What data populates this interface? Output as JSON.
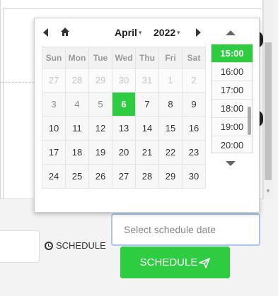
{
  "picker": {
    "month": "April",
    "year": "2022",
    "weekdays": [
      "Sun",
      "Mon",
      "Tue",
      "Wed",
      "Thu",
      "Fri",
      "Sat"
    ],
    "weeks": [
      [
        "27",
        "28",
        "29",
        "30",
        "31",
        "1",
        "2"
      ],
      [
        "3",
        "4",
        "5",
        "6",
        "7",
        "8",
        "9"
      ],
      [
        "10",
        "11",
        "12",
        "13",
        "14",
        "15",
        "16"
      ],
      [
        "17",
        "18",
        "19",
        "20",
        "21",
        "22",
        "23"
      ],
      [
        "24",
        "25",
        "26",
        "27",
        "28",
        "29",
        "30"
      ]
    ],
    "selected_day": "6",
    "times": [
      "15:00",
      "16:00",
      "17:00",
      "18:00",
      "19:00",
      "20:00"
    ],
    "selected_time": "15:00"
  },
  "form": {
    "schedule_label": "SCHEDULE",
    "date_placeholder": "Select schedule date",
    "schedule_button": "SCHEDULE"
  },
  "colors": {
    "accent": "#2ecc40",
    "input_border": "#a9c6f0"
  },
  "icons": {
    "prev": "chevron-left-icon",
    "home": "home-icon",
    "next": "chevron-right-icon",
    "time_up": "caret-up-icon",
    "time_down": "caret-down-icon",
    "clock": "clock-icon",
    "send": "send-icon"
  }
}
